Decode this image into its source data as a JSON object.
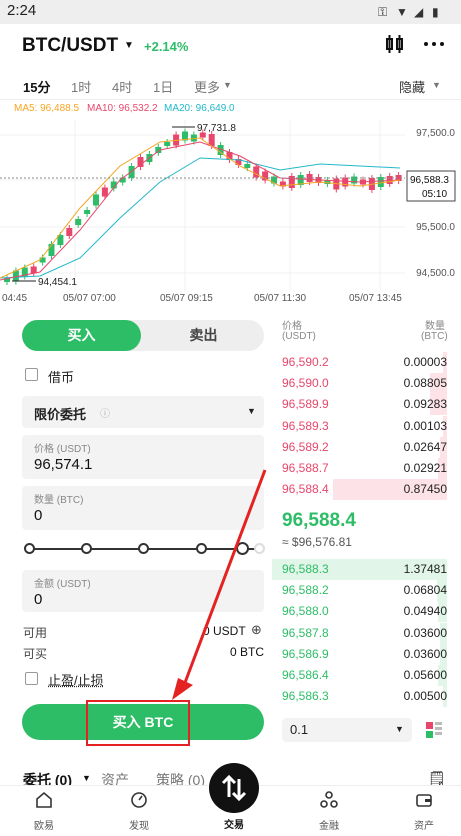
{
  "status": {
    "time": "2:24"
  },
  "header": {
    "pair": "BTC/USDT",
    "change": "+2.14%"
  },
  "timeframes": [
    "15分",
    "1时",
    "4时",
    "1日",
    "更多"
  ],
  "hide_label": "隐藏",
  "ma": {
    "ma5": "MA5: 96,488.5",
    "ma10": "MA10: 96,532.2",
    "ma20": "MA20: 96,649.0"
  },
  "chart_data": {
    "type": "candlestick",
    "x_ticks": [
      "04:45",
      "05/07 07:00",
      "05/07 09:15",
      "05/07 11:30",
      "05/07 13:45"
    ],
    "y_ticks": [
      "97,500.0",
      "96,500.0",
      "95,500.0",
      "94,500.0"
    ],
    "high_label": "97,731.8",
    "low_label": "94,454.1",
    "last_price": "96,588.3",
    "countdown": "05:10",
    "colors": {
      "up": "#2ebd67",
      "down": "#e8476b",
      "ma5": "#f5a623",
      "ma10": "#e8476b",
      "ma20": "#23b8c9"
    }
  },
  "form": {
    "tab_buy": "买入",
    "tab_sell": "卖出",
    "margin_label": "借币",
    "order_type": "限价委托",
    "price_label": "价格 (USDT)",
    "price_value": "96,574.1",
    "amount_label": "数量 (BTC)",
    "amount_value": "0",
    "total_label": "金额 (USDT)",
    "total_value": "0",
    "available_label": "可用",
    "available_value": "0 USDT",
    "canbuy_label": "可买",
    "canbuy_value": "0 BTC",
    "tpsl_label": "止盈/止损",
    "buy_button": "买入 BTC"
  },
  "orderbook": {
    "price_header": "价格",
    "price_unit": "(USDT)",
    "qty_header": "数量",
    "qty_unit": "(BTC)",
    "asks": [
      {
        "price": "96,590.2",
        "qty": "0.00003",
        "depth": 0.02
      },
      {
        "price": "96,590.0",
        "qty": "0.08805",
        "depth": 0.1
      },
      {
        "price": "96,589.9",
        "qty": "0.09283",
        "depth": 0.1
      },
      {
        "price": "96,589.3",
        "qty": "0.00103",
        "depth": 0.02
      },
      {
        "price": "96,589.2",
        "qty": "0.02647",
        "depth": 0.04
      },
      {
        "price": "96,588.7",
        "qty": "0.02921",
        "depth": 0.05
      },
      {
        "price": "96,588.4",
        "qty": "0.87450",
        "depth": 0.65
      }
    ],
    "mid_price": "96,588.4",
    "mid_fiat": "≈ $96,576.81",
    "bids": [
      {
        "price": "96,588.3",
        "qty": "1.37481",
        "depth": 1.0
      },
      {
        "price": "96,588.2",
        "qty": "0.06804",
        "depth": 0.06
      },
      {
        "price": "96,588.0",
        "qty": "0.04940",
        "depth": 0.05
      },
      {
        "price": "96,587.8",
        "qty": "0.03600",
        "depth": 0.04
      },
      {
        "price": "96,586.9",
        "qty": "0.03600",
        "depth": 0.04
      },
      {
        "price": "96,586.4",
        "qty": "0.05600",
        "depth": 0.05
      },
      {
        "price": "96,586.3",
        "qty": "0.00500",
        "depth": 0.02
      }
    ],
    "depth_value": "0.1"
  },
  "bottom": {
    "orders": "委托 (0)",
    "assets": "资产",
    "strategy": "策略 (0)"
  },
  "nav": [
    "欧易",
    "发现",
    "交易",
    "金融",
    "资产"
  ]
}
